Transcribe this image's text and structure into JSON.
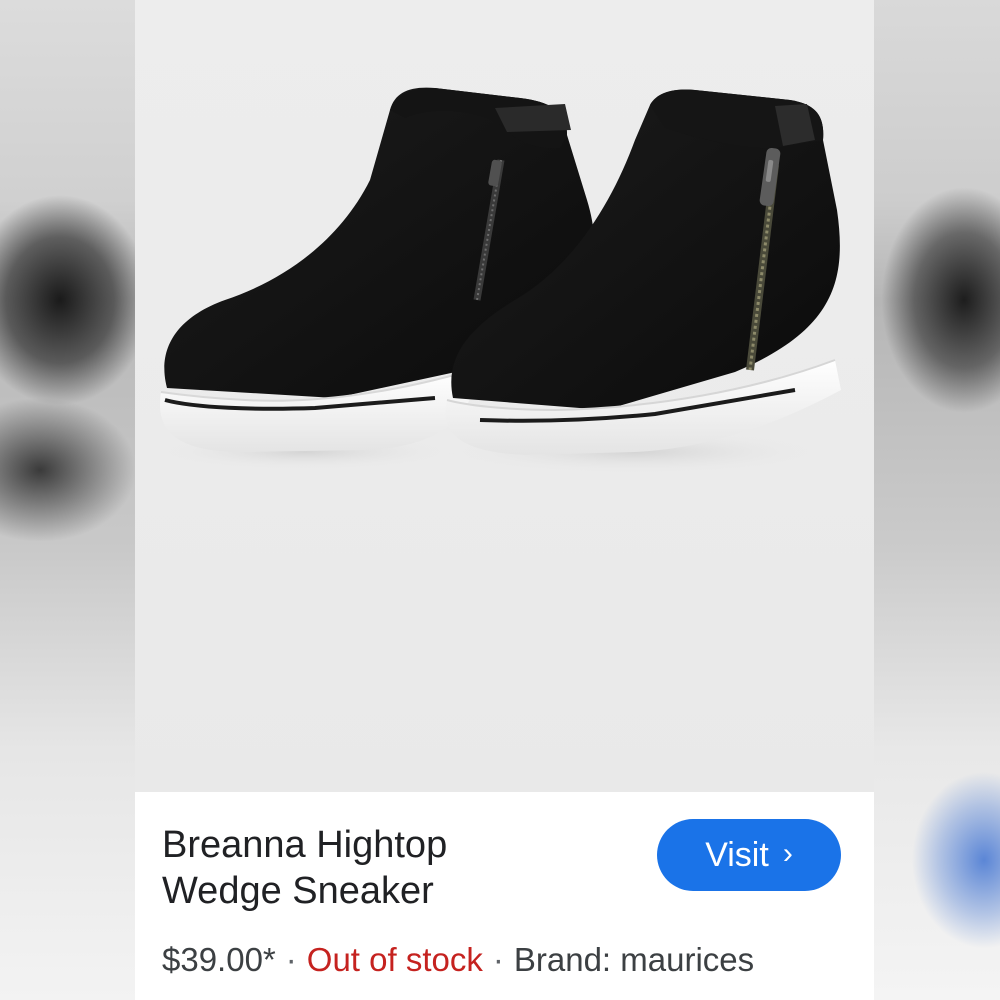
{
  "product": {
    "title_line1": "Breanna Hightop",
    "title_line2": "Wedge Sneaker",
    "price": "$39.00*",
    "stock_status": "Out of stock",
    "brand_label": "Brand: maurices",
    "separator": "·"
  },
  "actions": {
    "visit_label": "Visit",
    "visit_chevron": "›"
  },
  "colors": {
    "visit_button": "#1a73e8",
    "stock_status": "#c5221f",
    "title_text": "#202124"
  },
  "icons": {
    "visit_chevron": "chevron-right-icon"
  }
}
